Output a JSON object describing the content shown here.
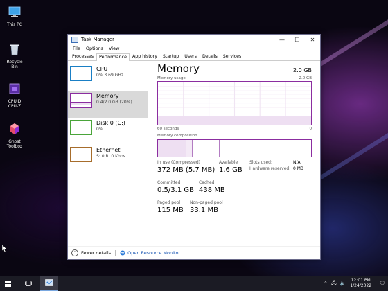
{
  "desktop": {
    "icons": [
      {
        "label": "This PC",
        "icon": "monitor-icon"
      },
      {
        "label": "Recycle Bin",
        "icon": "recycle-bin-icon"
      },
      {
        "label": "CPUID CPU-Z",
        "icon": "cpu-z-icon"
      },
      {
        "label": "Ghost Toolbox",
        "icon": "ghost-toolbox-icon"
      }
    ]
  },
  "window": {
    "title": "Task Manager",
    "controls": {
      "minimize": "—",
      "maximize": "☐",
      "close": "✕"
    },
    "menu": [
      "File",
      "Options",
      "View"
    ],
    "tabs": [
      "Processes",
      "Performance",
      "App history",
      "Startup",
      "Users",
      "Details",
      "Services"
    ],
    "active_tab": "Performance",
    "sidebar": [
      {
        "name": "CPU",
        "sub": "0% 3.69 GHz",
        "color": "#1a7fc5"
      },
      {
        "name": "Memory",
        "sub": "0.4/2.0 GB (20%)",
        "color": "#8b2da0"
      },
      {
        "name": "Disk 0 (C:)",
        "sub": "0%",
        "color": "#4aa53a"
      },
      {
        "name": "Ethernet",
        "sub": "S: 0 R: 0 Kbps",
        "color": "#a76d2c"
      }
    ],
    "memory": {
      "title": "Memory",
      "total": "2.0 GB",
      "usage_label": "Memory usage",
      "usage_max": "2.0 GB",
      "time_label": "60 seconds",
      "time_zero": "0",
      "composition_label": "Memory composition",
      "graph_level_fraction": 0.2,
      "stats": {
        "in_use_label": "In use (Compressed)",
        "in_use": "372 MB (5.7 MB)",
        "available_label": "Available",
        "available": "1.6 GB",
        "committed_label": "Committed",
        "committed": "0.5/3.1 GB",
        "cached_label": "Cached",
        "cached": "438 MB",
        "paged_label": "Paged pool",
        "paged": "115 MB",
        "nonpaged_label": "Non-paged pool",
        "nonpaged": "33.1 MB",
        "slots_label": "Slots used:",
        "slots": "N/A",
        "hwres_label": "Hardware reserved:",
        "hwres": "0 MB"
      }
    },
    "footer": {
      "fewer": "Fewer details",
      "monitor": "Open Resource Monitor"
    }
  },
  "taskbar": {
    "time": "12:01 PM",
    "date": "1/24/2022"
  },
  "colors": {
    "memory_accent": "#8b2da0",
    "link": "#1a57b4"
  }
}
